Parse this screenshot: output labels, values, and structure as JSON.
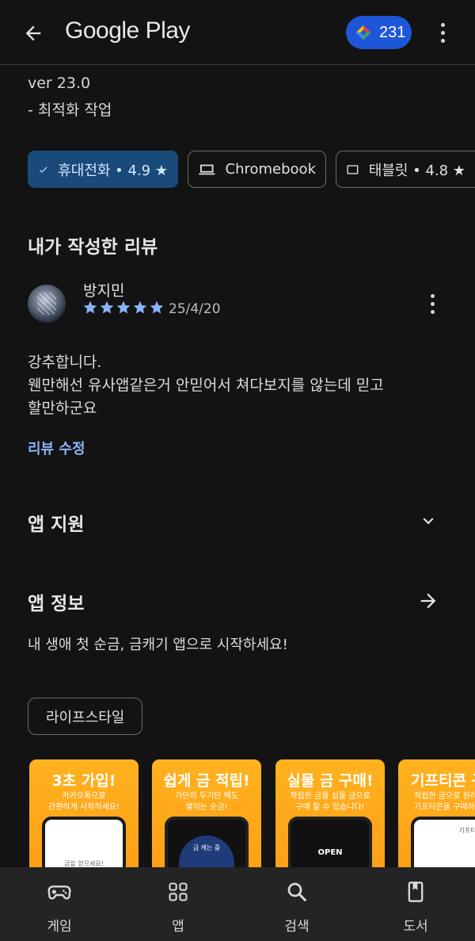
{
  "header": {
    "brand": "Google Play",
    "points": "231"
  },
  "whats_new": {
    "version": "ver 23.0",
    "note": "- 최적화 작업"
  },
  "device_chips": [
    {
      "label": "휴대전화 • 4.9 ★",
      "active": true
    },
    {
      "label": "Chromebook",
      "active": false
    },
    {
      "label": "태블릿 • 4.8 ★",
      "active": false
    }
  ],
  "my_review": {
    "title": "내가 작성한 리뷰",
    "reviewer": "방지민",
    "rating": 5,
    "date": "25/4/20",
    "text_lines": [
      "강추합니다.",
      "웬만해선 유사앱같은거 안믿어서 쳐다보지를 않는데 믿고",
      "할만하군요"
    ],
    "edit_label": "리뷰 수정"
  },
  "app_support": {
    "title": "앱 지원"
  },
  "app_info": {
    "title": "앱 정보",
    "description": "내 생애 첫 순금, 금캐기 앱으로 시작하세요!",
    "category": "라이프스타일"
  },
  "screenshots": [
    {
      "title": "3초 가입!",
      "sub1": "카카오톡으로",
      "sub2": "간편하게 시작하세요!",
      "screen_text": "금을 얻으세요!"
    },
    {
      "title": "쉽게 금 적립!",
      "sub1": "가만히 두기만 해도",
      "sub2": "쌓이는 순금!",
      "screen_text": "금 캐는 중"
    },
    {
      "title": "실물 금 구매!",
      "sub1": "적립한 금을 실물 금으로",
      "sub2": "구매 할 수 있습니다!",
      "screen_text": "OPEN"
    },
    {
      "title": "기프티콘 구",
      "sub1": "적립한 금으로 원하",
      "sub2": "기프티콘을 구매하",
      "screen_text": "기프티콘"
    }
  ],
  "bottom_nav": [
    {
      "label": "게임",
      "icon": "gamepad-icon"
    },
    {
      "label": "앱",
      "icon": "apps-grid-icon"
    },
    {
      "label": "검색",
      "icon": "search-icon"
    },
    {
      "label": "도서",
      "icon": "book-icon"
    }
  ],
  "colors": {
    "background": "#131313",
    "accent_blue": "#8ab4f8",
    "star_blue": "#8ab4f8",
    "points_pill": "#1d57d8",
    "active_chip": "#1a4a7a",
    "screenshot_orange": "#ff9a14"
  }
}
